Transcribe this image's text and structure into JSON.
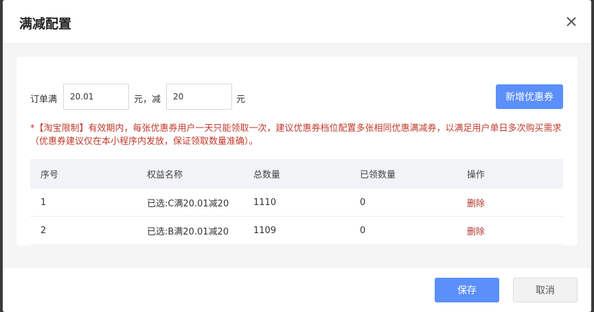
{
  "dialog": {
    "title": "满减配置",
    "close_icon": "close-icon"
  },
  "form": {
    "order_label": "订单满",
    "threshold_value": "20.01",
    "unit_comma_label": "元，减",
    "discount_value": "20",
    "unit_label": "元",
    "add_button_label": "新增优惠券"
  },
  "notice": "*【淘宝限制】有效期内，每张优惠券用户一天只能领取一次，建议优惠券档位配置多张相同优惠满减券，以满足用户单日多次购买需求（优惠券建议仅在本小程序内发放，保证领取数量准确）。",
  "table": {
    "headers": [
      "序号",
      "权益名称",
      "总数量",
      "已领数量",
      "操作"
    ],
    "rows": [
      {
        "index": "1",
        "name": "已选:C满20.01减20",
        "total": "1110",
        "claimed": "0",
        "action": "删除"
      },
      {
        "index": "2",
        "name": "已选:B满20.01减20",
        "total": "1109",
        "claimed": "0",
        "action": "删除"
      }
    ]
  },
  "footer": {
    "save_label": "保存",
    "cancel_label": "取消"
  },
  "colors": {
    "primary": "#5b8ff9",
    "warning_text": "#c0392b",
    "delete_link": "#b03a2e"
  }
}
